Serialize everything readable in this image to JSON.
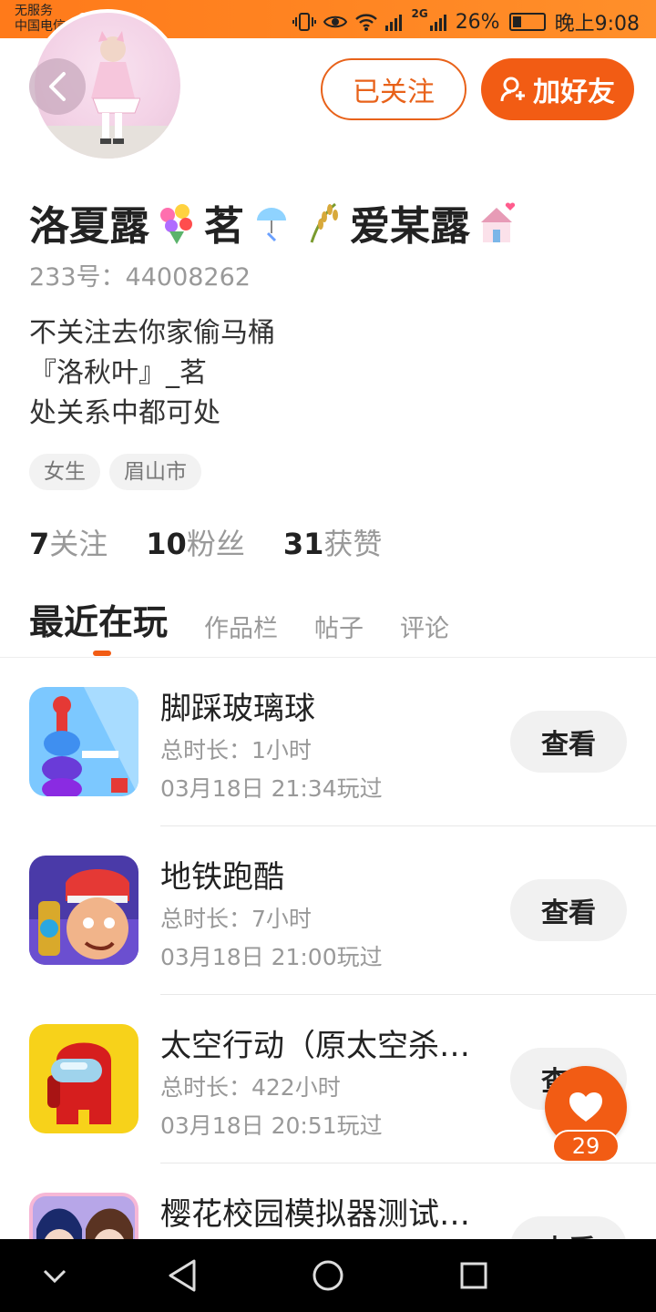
{
  "status_bar": {
    "carrier_line1": "无服务",
    "carrier_line2": "中国电信",
    "network_type": "2G",
    "battery": "26%",
    "time": "晚上9:08"
  },
  "header": {
    "follow_label": "已关注",
    "add_friend_label": "加好友"
  },
  "profile": {
    "name_parts": [
      "洛夏露",
      "茗",
      "爱某露"
    ],
    "uid": "233号：44008262",
    "bio": [
      "不关注去你家偷马桶",
      "『洛秋叶』_茗",
      "处关系中都可处"
    ],
    "tags": [
      "女生",
      "眉山市"
    ],
    "stats": {
      "following_num": "7",
      "following_label": "关注",
      "fans_num": "10",
      "fans_label": "粉丝",
      "likes_num": "31",
      "likes_label": "获赞"
    }
  },
  "tabs": [
    "最近在玩",
    "作品栏",
    "帖子",
    "评论"
  ],
  "games": [
    {
      "title": "脚踩玻璃球",
      "duration": "总时长：1小时",
      "played": "03月18日 21:34玩过",
      "button": "查看"
    },
    {
      "title": "地铁跑酷",
      "duration": "总时长：7小时",
      "played": "03月18日 21:00玩过",
      "button": "查看"
    },
    {
      "title": "太空行动（原太空杀…",
      "duration": "总时长：422小时",
      "played": "03月18日 20:51玩过",
      "button": "查看"
    },
    {
      "title": "樱花校园模拟器测试…",
      "duration": "",
      "played": "",
      "button": "查看"
    }
  ],
  "like_fab": {
    "count": "29"
  },
  "colors": {
    "accent": "#f25c14",
    "status_bar": "#ff7a1a"
  }
}
